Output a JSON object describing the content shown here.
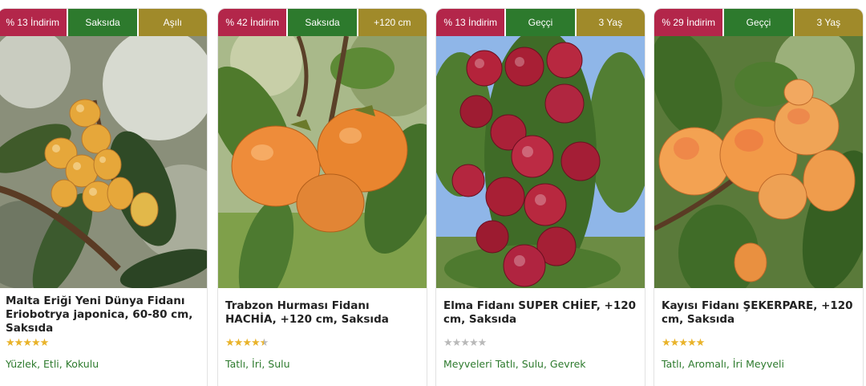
{
  "products": [
    {
      "badges": [
        "% 13 İndirim",
        "Saksıda",
        "Aşılı"
      ],
      "image_alt": "loquat-photo",
      "title": "Malta Eriği Yeni Dünya Fidanı Eriobotrya japonica, 60-80 cm, Saksıda",
      "rating": 5,
      "features": "Yüzlek, Etli, Kokulu"
    },
    {
      "badges": [
        "% 42 İndirim",
        "Saksıda",
        "+120 cm"
      ],
      "image_alt": "persimmon-photo",
      "title": "Trabzon Hurması Fidanı HACHİA, +120 cm, Saksıda",
      "rating": 4.5,
      "features": "Tatlı, İri, Sulu"
    },
    {
      "badges": [
        "% 13 İndirim",
        "Geççi",
        "3 Yaş"
      ],
      "image_alt": "apple-photo",
      "title": "Elma Fidanı SUPER CHİEF, +120 cm, Saksıda",
      "rating": 0,
      "features": "Meyveleri Tatlı, Sulu, Gevrek"
    },
    {
      "badges": [
        "% 29 İndirim",
        "Geççi",
        "3 Yaş"
      ],
      "image_alt": "apricot-photo",
      "title": "Kayısı Fidanı ŞEKERPARE, +120 cm, Saksıda",
      "rating": 5,
      "features": "Tatlı, Aromalı, İri Meyveli"
    }
  ],
  "colors": {
    "discount": "#b3264a",
    "pot": "#2d7a2d",
    "info": "#a08a2a",
    "star": "#e9b32a",
    "star_empty": "#b9b9b9",
    "features_text": "#2d7a2d"
  }
}
